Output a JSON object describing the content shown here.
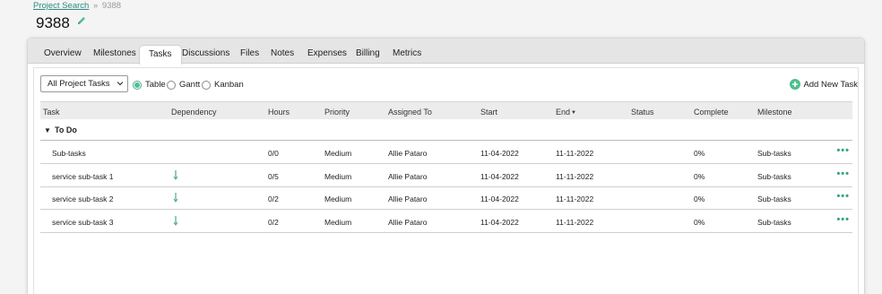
{
  "breadcrumb": {
    "link": "Project Search",
    "sep": "»",
    "current": "9388"
  },
  "page_title": "9388",
  "tabs": [
    "Overview",
    "Milestones",
    "Tasks",
    "Discussions",
    "Files",
    "Notes",
    "Expenses",
    "Billing",
    "Metrics"
  ],
  "active_tab": "Tasks",
  "filter": {
    "selected": "All Project Tasks"
  },
  "views": {
    "table": "Table",
    "gantt": "Gantt",
    "kanban": "Kanban",
    "selected": "Table"
  },
  "add_task_label": "Add New Task",
  "columns": [
    "Task",
    "Dependency",
    "Hours",
    "Priority",
    "Assigned To",
    "Start",
    "End",
    "Status",
    "Complete",
    "Milestone"
  ],
  "sort_column": "End",
  "group": {
    "label": "To Do"
  },
  "rows": [
    {
      "task": "Sub-tasks",
      "dependency": false,
      "hours": "0/0",
      "priority": "Medium",
      "assigned": "Allie Pataro",
      "start": "11-04-2022",
      "end": "11-11-2022",
      "status": "",
      "complete": "0%",
      "milestone": "Sub-tasks"
    },
    {
      "task": "service sub-task 1",
      "dependency": true,
      "hours": "0/5",
      "priority": "Medium",
      "assigned": "Allie Pataro",
      "start": "11-04-2022",
      "end": "11-11-2022",
      "status": "",
      "complete": "0%",
      "milestone": "Sub-tasks"
    },
    {
      "task": "service sub-task 2",
      "dependency": true,
      "hours": "0/2",
      "priority": "Medium",
      "assigned": "Allie Pataro",
      "start": "11-04-2022",
      "end": "11-11-2022",
      "status": "",
      "complete": "0%",
      "milestone": "Sub-tasks"
    },
    {
      "task": "service sub-task 3",
      "dependency": true,
      "hours": "0/2",
      "priority": "Medium",
      "assigned": "Allie Pataro",
      "start": "11-04-2022",
      "end": "11-11-2022",
      "status": "",
      "complete": "0%",
      "milestone": "Sub-tasks"
    }
  ],
  "colors": {
    "accent": "#4fbf8e",
    "link": "#2a8a82",
    "header_bg": "#ececec"
  },
  "icons": {
    "edit": "pencil-icon",
    "add": "plus-circle-icon",
    "more": "ellipsis-icon",
    "dependency": "dependency-arrow-icon",
    "dropdown": "chevron-down-icon"
  }
}
